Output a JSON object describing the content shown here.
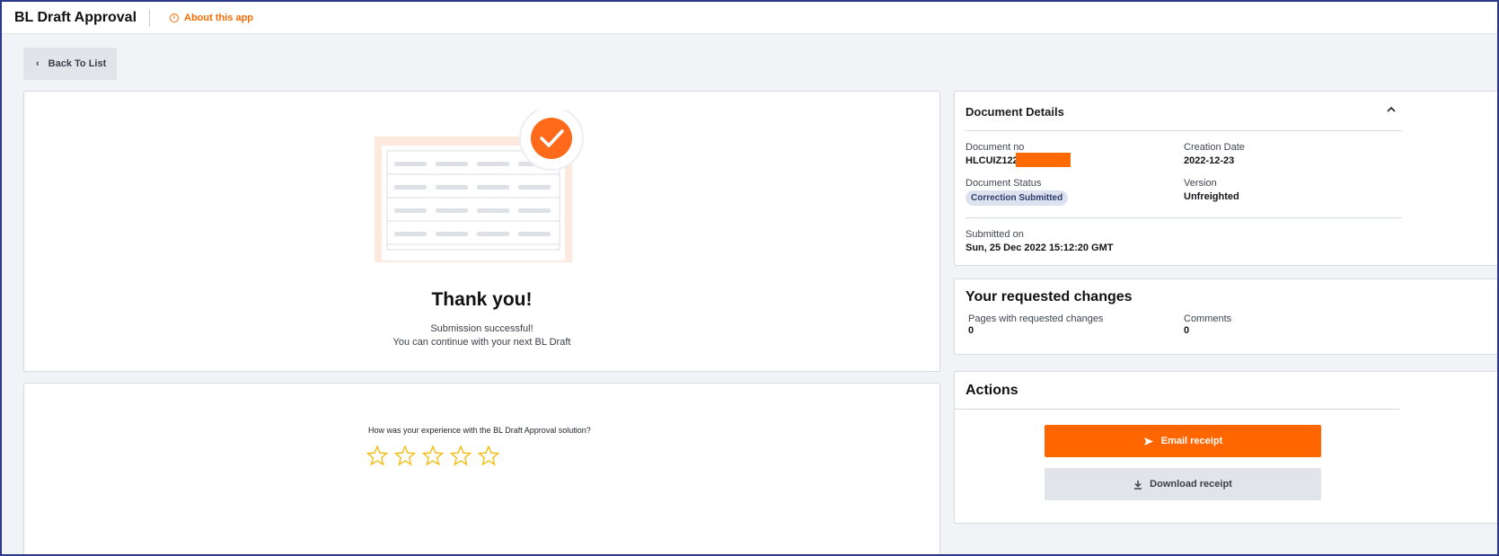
{
  "header": {
    "app_title": "BL Draft Approval",
    "about_label": "About this app"
  },
  "nav": {
    "back_label": "Back To List"
  },
  "thank_you": {
    "title": "Thank you!",
    "line1": "Submission successful!",
    "line2": "You can continue with your next BL Draft"
  },
  "feedback": {
    "question": "How was your experience with the BL Draft Approval solution?",
    "rating": 0,
    "max_rating": 5
  },
  "document_details": {
    "title": "Document Details",
    "document_no_label": "Document no",
    "document_no_value": "HLCUIZ122",
    "creation_date_label": "Creation Date",
    "creation_date_value": "2022-12-23",
    "status_label": "Document Status",
    "status_value": "Correction Submitted",
    "version_label": "Version",
    "version_value": "Unfreighted",
    "submitted_label": "Submitted on",
    "submitted_value": "Sun, 25 Dec 2022 15:12:20 GMT"
  },
  "requested_changes": {
    "title": "Your requested changes",
    "pages_label": "Pages with requested changes",
    "pages_value": "0",
    "comments_label": "Comments",
    "comments_value": "0"
  },
  "actions": {
    "title": "Actions",
    "email_label": "Email receipt",
    "download_label": "Download receipt"
  },
  "colors": {
    "accent": "#ff6600",
    "badge_bg": "#dde2f1",
    "star": "#f5b800"
  },
  "icons": {
    "about": "info-icon",
    "back": "chevron-left-icon",
    "success": "checkmark-icon",
    "collapse": "chevron-up-icon",
    "email": "send-icon",
    "download": "download-icon",
    "rating": "star-outline-icon"
  }
}
